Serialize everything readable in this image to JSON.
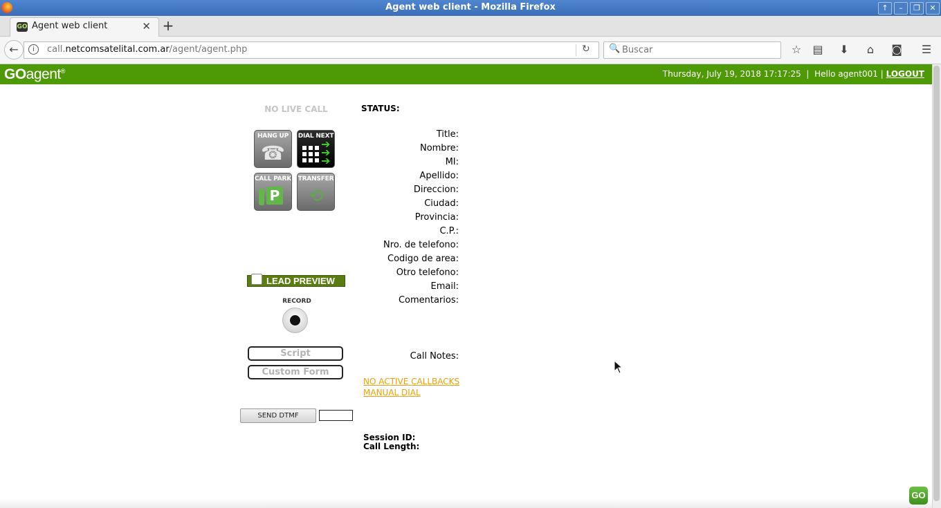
{
  "window": {
    "title": "Agent web client - Mozilla Firefox",
    "controls": [
      "↑",
      "–",
      "❐",
      "✕"
    ]
  },
  "tab": {
    "favicon_text": "GO",
    "label": "Agent web client",
    "close": "✕",
    "new_tab": "+"
  },
  "navbar": {
    "back": "←",
    "info": "i",
    "url_prefix": "call.",
    "url_domain": "netcomsatelital.com.ar",
    "url_path": "/agent/agent.php",
    "reload": "↻",
    "search_placeholder": "Buscar",
    "search_icon": "🔍",
    "icons": {
      "bookmark": "☆",
      "library": "▤",
      "download": "⬇",
      "home": "⌂",
      "pocket": "◙",
      "menu": "☰"
    }
  },
  "header": {
    "logo_go": "GO",
    "logo_agent": "agent",
    "logo_reg": "®",
    "datetime": "Thursday, July 19, 2018 17:17:25",
    "sep": "|",
    "greeting": "Hello agent001",
    "logout": "LOGOUT",
    "brand_color": "#4e9a06"
  },
  "left": {
    "call_state": "NO LIVE CALL",
    "buttons": {
      "hangup": "HANG UP",
      "dialnext": "DIAL NEXT",
      "callpark": "CALL PARK",
      "transfer": "TRANSFER",
      "park_letter": "P"
    },
    "lead_preview": "LEAD PREVIEW",
    "record_label": "RECORD",
    "script_btn": "Script",
    "custom_form_btn": "Custom Form",
    "send_dtmf": "SEND DTMF"
  },
  "middle": {
    "status_label": "STATUS:",
    "fields": [
      "Title:",
      "Nombre:",
      "MI:",
      "Apellido:",
      "Direccion:",
      "Ciudad:",
      "Provincia:",
      "C.P.:",
      "Nro. de telefono:",
      "Codigo de area:",
      "Otro telefono:",
      "Email:",
      "Comentarios:"
    ],
    "call_notes": "Call Notes:",
    "links": {
      "callbacks": "NO ACTIVE CALLBACKS",
      "manual_dial": "MANUAL DIAL"
    },
    "session_id": "Session ID:",
    "call_length": "Call Length:"
  },
  "footer": {
    "go_badge": "GO"
  }
}
